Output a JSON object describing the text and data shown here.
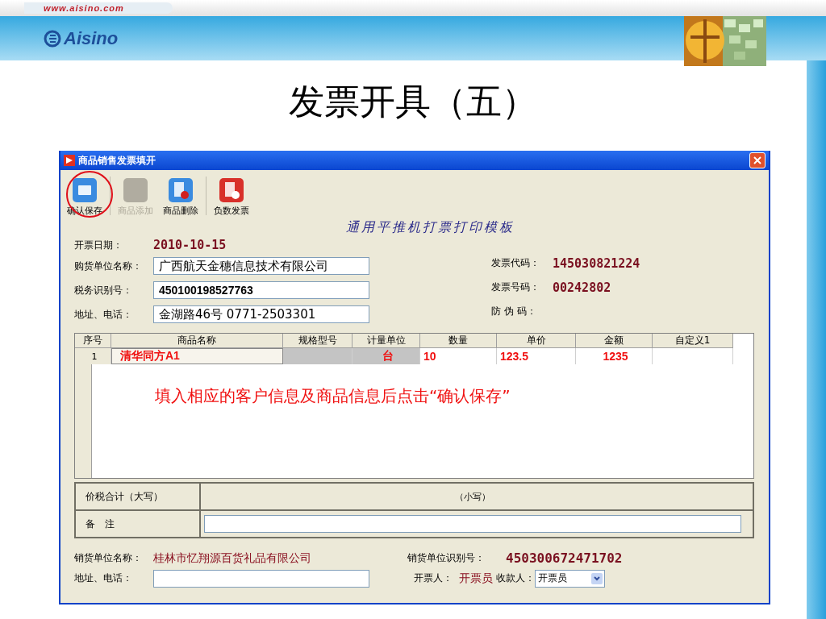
{
  "site_url": "www.aisino.com",
  "logo": "Aisino",
  "slide_title": "发票开具（五）",
  "window": {
    "title": "商品销售发票填开"
  },
  "toolbar": [
    {
      "label": "确认保存",
      "kind": "save",
      "disabled": false,
      "highlighted": true
    },
    {
      "label": "商品添加",
      "kind": "add",
      "disabled": true,
      "highlighted": false
    },
    {
      "label": "商品删除",
      "kind": "delete",
      "disabled": false,
      "highlighted": false
    },
    {
      "label": "负数发票",
      "kind": "negative",
      "disabled": false,
      "highlighted": false
    }
  ],
  "template_title": "通用平推机打票打印模板",
  "invoice_date": {
    "label": "开票日期：",
    "value": "2010-10-15"
  },
  "buyer_fields": [
    {
      "label": "购货单位名称：",
      "value": "广西航天金穗信息技术有限公司"
    },
    {
      "label": "税务识别号：",
      "value": "450100198527763"
    },
    {
      "label": "地址、电话：",
      "value": "金湖路46号 0771-2503301"
    }
  ],
  "invoice_info": [
    {
      "label": "发票代码：",
      "value": "145030821224"
    },
    {
      "label": "发票号码：",
      "value": "00242802"
    },
    {
      "label": "防 伪 码："
    }
  ],
  "table": {
    "columns": [
      "序号",
      "商品名称",
      "规格型号",
      "计量单位",
      "数量",
      "单价",
      "金额",
      "自定义1"
    ],
    "rows": [
      {
        "index": "1",
        "name": "清华同方A1",
        "unit": "台",
        "quantity": "10",
        "price": "123.5",
        "amount": "1235"
      }
    ]
  },
  "annotation": "填入相应的客户信息及商品信息后点击“确认保存”",
  "total": {
    "label": "价税合计（大写）",
    "small_label": "（小写）"
  },
  "remarks": {
    "label": "备　注"
  },
  "seller": {
    "name_label": "销货单位名称：",
    "name": "桂林市忆翔源百货礼品有限公司",
    "id_label": "销货单位识别号：",
    "id": "450300672471702",
    "address_label": "地址、电话："
  },
  "issuer": {
    "label": "开票人：",
    "value": "开票员"
  },
  "payee": {
    "label": "收款人：",
    "value": "开票员"
  }
}
